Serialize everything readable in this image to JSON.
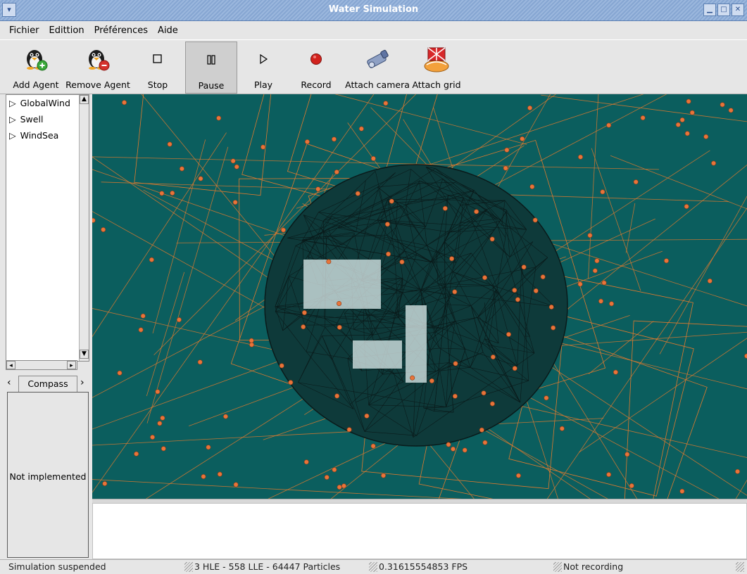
{
  "window": {
    "title": "Water Simulation",
    "menu_icon": "chevron-down-icon"
  },
  "menubar": {
    "items": [
      {
        "label": "Fichier",
        "accent": "F"
      },
      {
        "label": "Edittion",
        "accent": "E"
      },
      {
        "label": "Préférences"
      },
      {
        "label": "Aide",
        "accent": "A"
      }
    ]
  },
  "toolbar": {
    "add_agent": "Add Agent",
    "remove_agent": "Remove Agent",
    "stop": "Stop",
    "pause": "Pause",
    "play": "Play",
    "record": "Record",
    "attach_camera": "Attach camera",
    "attach_grid": "Attach grid",
    "pressed": "Pause"
  },
  "tree": {
    "items": [
      {
        "label": "GlobalWind"
      },
      {
        "label": "Swell"
      },
      {
        "label": "WindSea"
      }
    ]
  },
  "tabs": {
    "compass": "Compass"
  },
  "compass_panel": {
    "message": "Not implemented"
  },
  "viewport": {
    "background": "#0b5e5e",
    "line_color": "#e07a2e",
    "mesh_color": "#0a1a1a"
  },
  "status": {
    "state": "Simulation suspended",
    "counts": "3 HLE - 558 LLE - 64447 Particles",
    "fps": "0.31615554853 FPS",
    "recording": "Not recording"
  }
}
